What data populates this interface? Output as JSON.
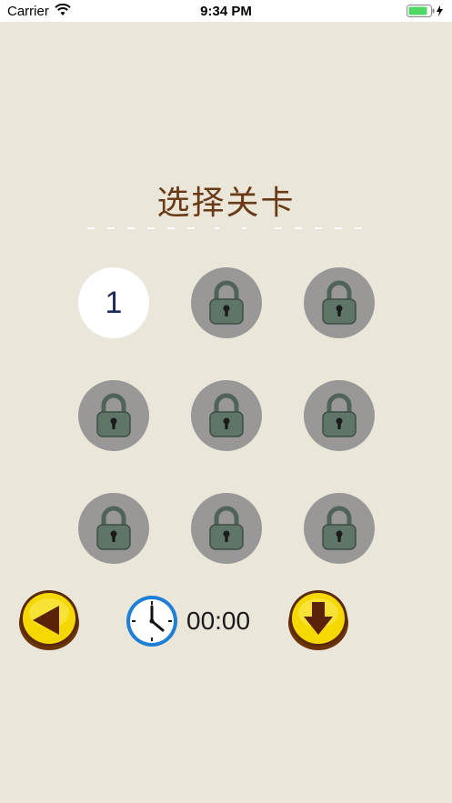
{
  "status": {
    "carrier": "Carrier",
    "time": "9:34 PM"
  },
  "title": "选择关卡",
  "levels": [
    {
      "label": "1",
      "state": "unlocked"
    },
    {
      "label": "",
      "state": "locked"
    },
    {
      "label": "",
      "state": "locked"
    },
    {
      "label": "",
      "state": "locked"
    },
    {
      "label": "",
      "state": "locked"
    },
    {
      "label": "",
      "state": "locked"
    },
    {
      "label": "",
      "state": "locked"
    },
    {
      "label": "",
      "state": "locked"
    },
    {
      "label": "",
      "state": "locked"
    }
  ],
  "footer": {
    "back_icon": "triangle-left-icon",
    "timer_icon": "clock-icon",
    "timer": "00:00",
    "download_icon": "arrow-down-icon"
  },
  "colors": {
    "background": "#ebe6da",
    "title": "#6a3a16",
    "button_yellow": "#f5d800",
    "button_dark": "#5a2a08",
    "locked_circle": "#999896",
    "lock_body": "#5f7568"
  }
}
